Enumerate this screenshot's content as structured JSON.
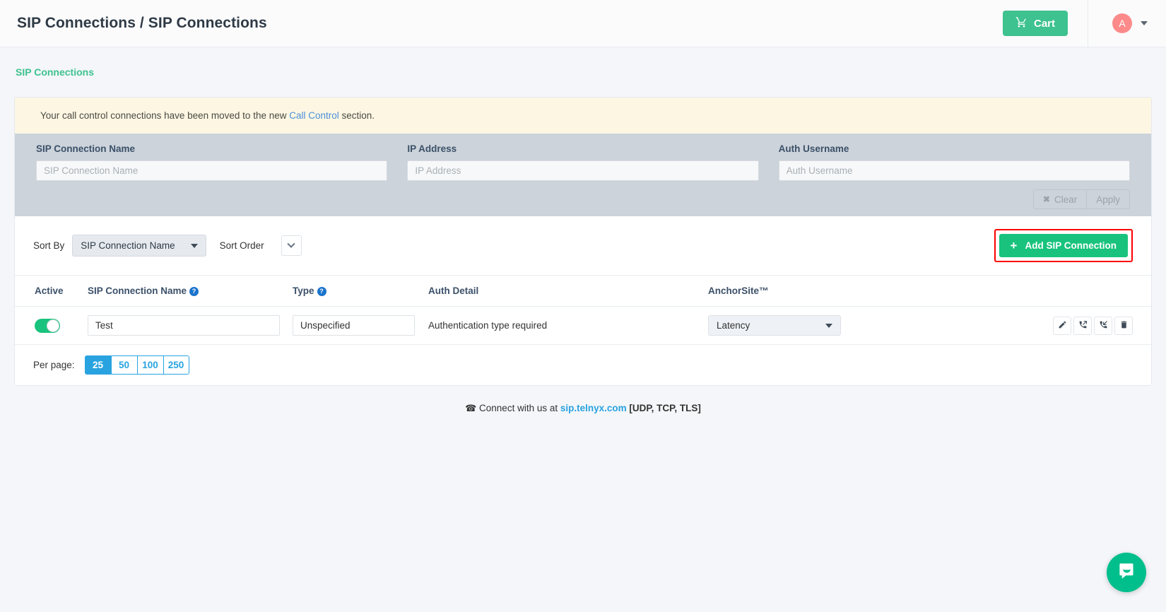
{
  "topbar": {
    "breadcrumb": "SIP Connections / SIP Connections",
    "cart_label": "Cart",
    "cart_icon": "shopping-cart-icon",
    "avatar_initial": "A",
    "accent_green": "#3ec28f",
    "avatar_color": "#fd8a8a"
  },
  "subheader": {
    "link_label": "SIP Connections"
  },
  "notice": {
    "text_before": "Your call control connections have been moved to the new ",
    "link_label": "Call Control",
    "text_after": " section."
  },
  "filters": {
    "name": {
      "label": "SIP Connection Name",
      "placeholder": "SIP Connection Name",
      "value": ""
    },
    "ip": {
      "label": "IP Address",
      "placeholder": "IP Address",
      "value": ""
    },
    "auth": {
      "label": "Auth Username",
      "placeholder": "Auth Username",
      "value": ""
    },
    "clear_label": "Clear",
    "clear_icon": "x-icon",
    "apply_label": "Apply"
  },
  "sortbar": {
    "sort_by_label": "Sort By",
    "sort_by_value": "SIP Connection Name",
    "sort_order_label": "Sort Order",
    "sort_order_icon": "chevron-down-icon",
    "add_button_label": "Add SIP Connection",
    "add_button_icon": "plus-icon",
    "highlight_color": "#ff0000"
  },
  "table": {
    "columns": [
      {
        "label": "Active",
        "help": false
      },
      {
        "label": "SIP Connection Name",
        "help": true
      },
      {
        "label": "Type",
        "help": true
      },
      {
        "label": "Auth Detail",
        "help": false
      },
      {
        "label": "AnchorSite™",
        "help": false
      }
    ],
    "help_glyph": "?",
    "rows": [
      {
        "active": true,
        "name": "Test",
        "type": "Unspecified",
        "auth_detail": "Authentication type required",
        "anchorsite": "Latency",
        "actions": [
          {
            "name": "edit-icon"
          },
          {
            "name": "outbound-call-icon"
          },
          {
            "name": "inbound-call-icon"
          },
          {
            "name": "delete-icon"
          }
        ]
      }
    ]
  },
  "pagination": {
    "label": "Per page:",
    "options": [
      "25",
      "50",
      "100",
      "250"
    ],
    "selected": "25"
  },
  "footer": {
    "phone_icon": "phone-icon",
    "text_before": "Connect with us at ",
    "link_label": "sip.telnyx.com",
    "protocols": "[UDP, TCP, TLS]"
  },
  "chat_widget": {
    "icon": "chat-bubble-icon",
    "color": "#00bf8c"
  }
}
